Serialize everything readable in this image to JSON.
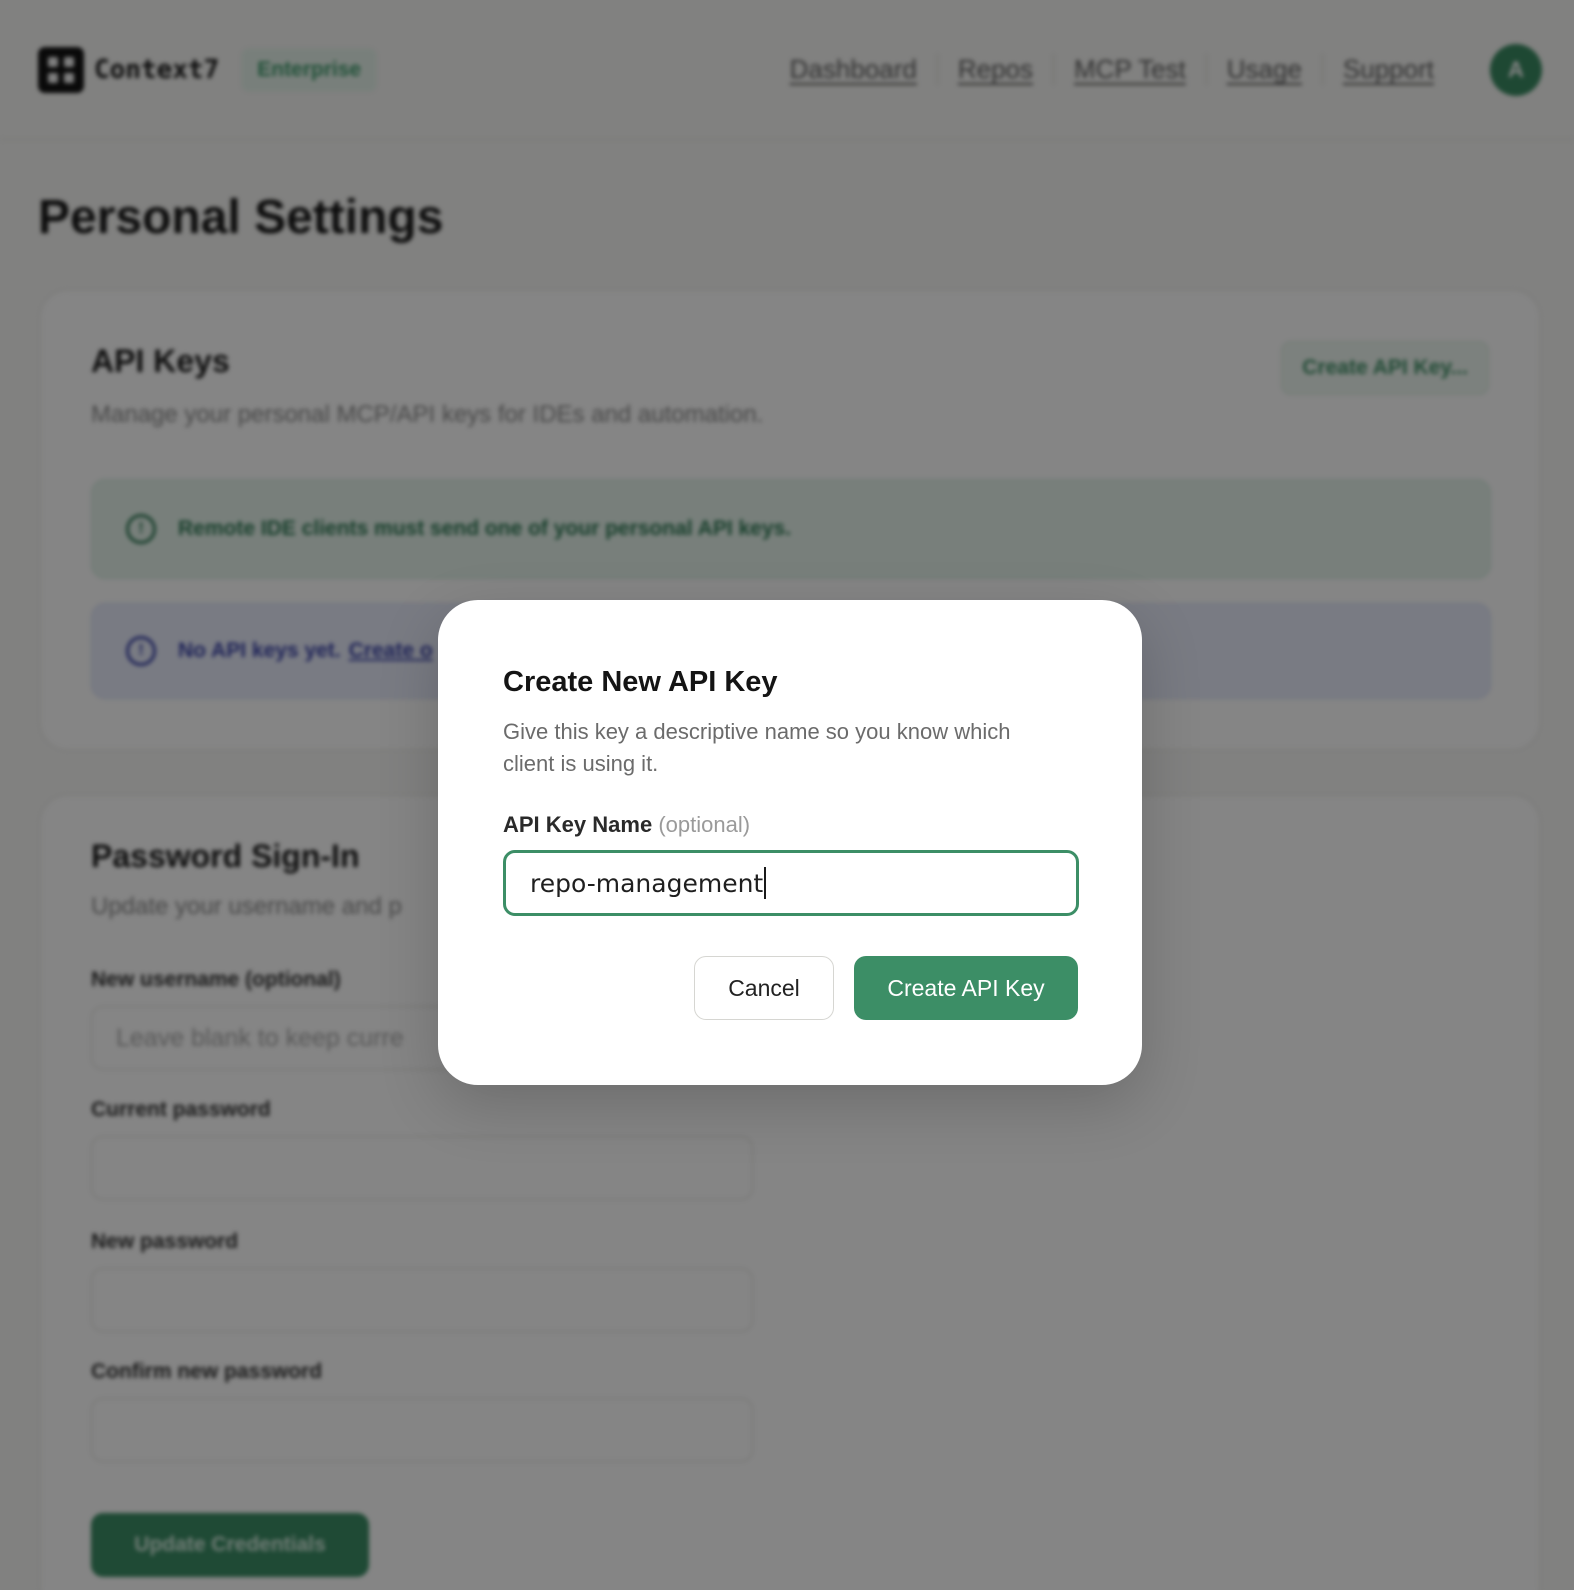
{
  "header": {
    "brand": "Context7",
    "tier_badge": "Enterprise",
    "nav": [
      "Dashboard",
      "Repos",
      "MCP Test",
      "Usage",
      "Support"
    ],
    "avatar_initial": "A"
  },
  "page": {
    "title": "Personal Settings"
  },
  "api_keys": {
    "title": "API Keys",
    "description": "Manage your personal MCP/API keys for IDEs and automation.",
    "create_button": "Create API Key...",
    "info_alert": "Remote IDE clients must send one of your personal API keys.",
    "empty_alert": "No API keys yet.",
    "empty_alert_link": "Create o"
  },
  "password": {
    "title": "Password Sign-In",
    "description": "Update your username and p",
    "username_label": "New username (optional)",
    "username_placeholder": "Leave blank to keep curre",
    "current_label": "Current password",
    "new_label": "New password",
    "confirm_label": "Confirm new password",
    "submit_button": "Update Credentials"
  },
  "modal": {
    "title": "Create New API Key",
    "description": "Give this key a descriptive name so you know which client is using it.",
    "field_label": "API Key Name",
    "field_optional": "(optional)",
    "field_value": "repo-management",
    "cancel_button": "Cancel",
    "submit_button": "Create API Key"
  },
  "colors": {
    "accent": "#3c8e66",
    "info_green_bg": "#e6f4ec",
    "info_blue_bg": "#e8ecfb",
    "overlay": "rgba(0,0,0,0.48)"
  }
}
